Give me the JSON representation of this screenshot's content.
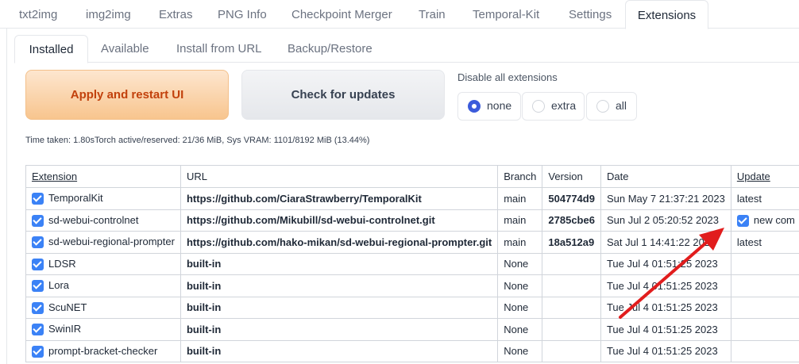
{
  "top_tabs": [
    "txt2img",
    "img2img",
    "Extras",
    "PNG Info",
    "Checkpoint Merger",
    "Train",
    "Temporal-Kit",
    "Settings",
    "Extensions"
  ],
  "sub_tabs": [
    "Installed",
    "Available",
    "Install from URL",
    "Backup/Restore"
  ],
  "buttons": {
    "apply": "Apply and restart UI",
    "check": "Check for updates"
  },
  "disable": {
    "label": "Disable all extensions",
    "options": [
      "none",
      "extra",
      "all"
    ],
    "selected": "none"
  },
  "time_taken": "Time taken: 1.80sTorch active/reserved: 21/36 MiB, Sys VRAM: 1101/8192 MiB (13.44%)",
  "table": {
    "headers": [
      "Extension",
      "URL",
      "Branch",
      "Version",
      "Date",
      "Update"
    ],
    "rows": [
      {
        "name": "TemporalKit",
        "url": "https://github.com/CiaraStrawberry/TemporalKit",
        "branch": "main",
        "version": "504774d9",
        "date": "Sun May 7 21:37:21 2023",
        "update": "latest"
      },
      {
        "name": "sd-webui-controlnet",
        "url": "https://github.com/Mikubill/sd-webui-controlnet.git",
        "branch": "main",
        "version": "2785cbe6",
        "date": "Sun Jul 2 05:20:52 2023",
        "update": "new com"
      },
      {
        "name": "sd-webui-regional-prompter",
        "url": "https://github.com/hako-mikan/sd-webui-regional-prompter.git",
        "branch": "main",
        "version": "18a512a9",
        "date": "Sat Jul 1 14:41:22 2023",
        "update": "latest"
      },
      {
        "name": "LDSR",
        "url": "built-in",
        "branch": "None",
        "version": "",
        "date": "Tue Jul 4 01:51:25 2023",
        "update": ""
      },
      {
        "name": "Lora",
        "url": "built-in",
        "branch": "None",
        "version": "",
        "date": "Tue Jul 4 01:51:25 2023",
        "update": ""
      },
      {
        "name": "ScuNET",
        "url": "built-in",
        "branch": "None",
        "version": "",
        "date": "Tue Jul 4 01:51:25 2023",
        "update": ""
      },
      {
        "name": "SwinIR",
        "url": "built-in",
        "branch": "None",
        "version": "",
        "date": "Tue Jul 4 01:51:25 2023",
        "update": ""
      },
      {
        "name": "prompt-bracket-checker",
        "url": "built-in",
        "branch": "None",
        "version": "",
        "date": "Tue Jul 4 01:51:25 2023",
        "update": ""
      }
    ]
  },
  "colors": {
    "accent": "#3b82f6",
    "apply_text": "#c2410c",
    "arrow": "#e11d1d"
  },
  "icons": [
    "checkbox-checked-icon",
    "radio-icon",
    "red-arrow-annotation"
  ]
}
